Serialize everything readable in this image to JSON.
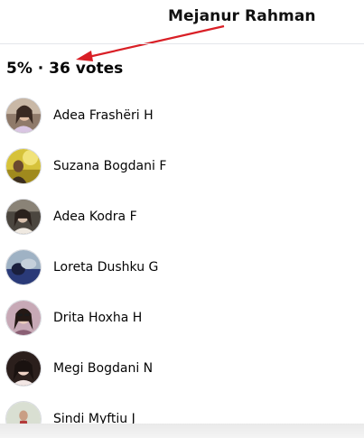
{
  "annotation": {
    "name": "Mejanur Rahman",
    "arrow_color": "#d91f26"
  },
  "poll": {
    "summary": "5% · 36 votes"
  },
  "voters": [
    {
      "name": "Adea Frashëri H",
      "avatar_icon": "profile-photo"
    },
    {
      "name": "Suzana Bogdani F",
      "avatar_icon": "profile-photo"
    },
    {
      "name": "Adea Kodra F",
      "avatar_icon": "profile-photo"
    },
    {
      "name": "Loreta Dushku G",
      "avatar_icon": "profile-photo"
    },
    {
      "name": "Drita Hoxha H",
      "avatar_icon": "profile-photo"
    },
    {
      "name": "Megi Bogdani N",
      "avatar_icon": "profile-photo"
    },
    {
      "name": "Sindi Myftiu J",
      "avatar_icon": "profile-photo"
    }
  ]
}
